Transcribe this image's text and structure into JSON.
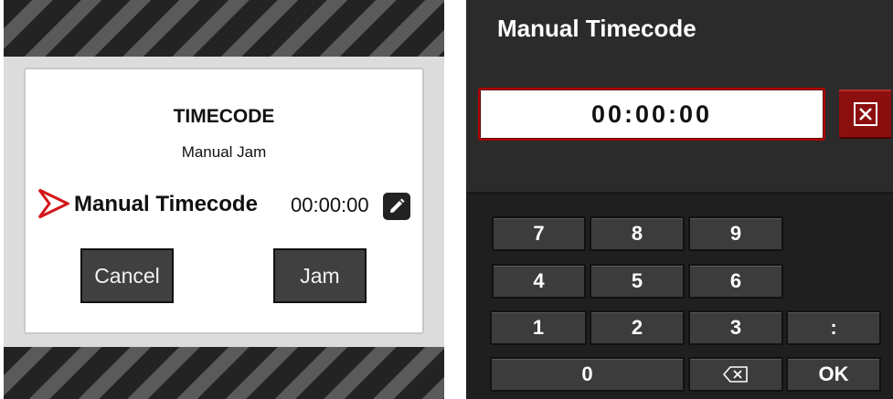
{
  "dialog": {
    "title": "TIMECODE",
    "subtitle": "Manual Jam",
    "row_label": "Manual Timecode",
    "row_value": "00:00:00",
    "cancel_label": "Cancel",
    "jam_label": "Jam",
    "accent_color": "#d4161b"
  },
  "entry": {
    "title": "Manual Timecode",
    "display_value": "00:00:00",
    "clear_icon": "clear-x-icon",
    "accent_color": "#8c0f0f"
  },
  "keypad": {
    "k7": "7",
    "k8": "8",
    "k9": "9",
    "k4": "4",
    "k5": "5",
    "k6": "6",
    "k1": "1",
    "k2": "2",
    "k3": "3",
    "colon": ":",
    "k0": "0",
    "backspace_icon": "backspace-icon",
    "ok": "OK"
  }
}
